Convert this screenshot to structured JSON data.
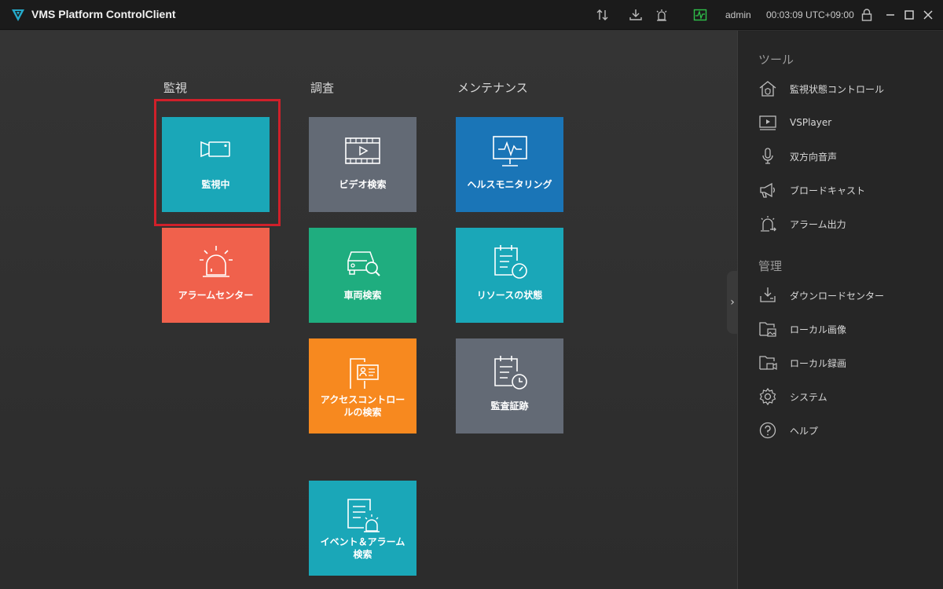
{
  "titlebar": {
    "app_title": "VMS Platform ControlClient",
    "user": "admin",
    "clock": "00:03:09 UTC+09:00",
    "icons": [
      "sort-icon",
      "download-icon",
      "alarm-icon",
      "health-icon",
      "lock-icon",
      "minimize-icon",
      "maximize-icon",
      "close-icon"
    ]
  },
  "sections": {
    "monitor": "監視",
    "investigate": "調査",
    "maintenance": "メンテナンス"
  },
  "tiles": {
    "live": {
      "label": "監視中",
      "color": "#1aa7b8"
    },
    "alarm_center": {
      "label": "アラームセンター",
      "color": "#f0614c"
    },
    "video_search": {
      "label": "ビデオ検索",
      "color": "#636a75"
    },
    "vehicle_search": {
      "label": "車両検索",
      "color": "#1fad7f"
    },
    "access_search": {
      "label": "アクセスコントロールの検索",
      "line1": "アクセスコントロー",
      "line2": "ルの検索",
      "color": "#f7891f"
    },
    "event_alarm_search": {
      "label": "イベント＆アラーム検索",
      "line1": "イベント＆アラーム",
      "line2": "検索",
      "color": "#1aa7b8"
    },
    "health_monitoring": {
      "label": "ヘルスモニタリング",
      "color": "#1a75b7"
    },
    "resource_status": {
      "label": "リソースの状態",
      "color": "#1aa7b8"
    },
    "audit_trail": {
      "label": "監査証跡",
      "color": "#636a75"
    }
  },
  "right_panel": {
    "tools_title": "ツール",
    "tools": [
      {
        "label": "監視状態コントロール",
        "icon": "home-shield-icon"
      },
      {
        "label": "VSPlayer",
        "icon": "player-icon"
      },
      {
        "label": "双方向音声",
        "icon": "microphone-icon"
      },
      {
        "label": "ブロードキャスト",
        "icon": "megaphone-icon"
      },
      {
        "label": "アラーム出力",
        "icon": "alarm-output-icon"
      }
    ],
    "manage_title": "管理",
    "manage": [
      {
        "label": "ダウンロードセンター",
        "icon": "download-center-icon"
      },
      {
        "label": "ローカル画像",
        "icon": "local-image-icon"
      },
      {
        "label": "ローカル録画",
        "icon": "local-recording-icon"
      },
      {
        "label": "システム",
        "icon": "gear-icon"
      },
      {
        "label": "ヘルプ",
        "icon": "help-icon"
      }
    ]
  },
  "colors": {
    "highlight": "#d0202a",
    "accent": "#1aa7b8"
  }
}
